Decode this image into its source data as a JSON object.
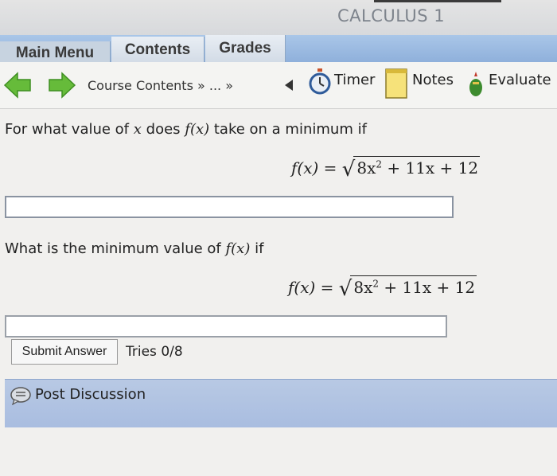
{
  "app": {
    "title": "CALCULUS 1"
  },
  "nav": {
    "tabs": [
      {
        "label": "Main Menu"
      },
      {
        "label": "Contents"
      },
      {
        "label": "Grades"
      }
    ]
  },
  "toolbar": {
    "breadcrumb": "Course Contents » ... »",
    "tools": [
      {
        "label": "Timer",
        "icon": "timer-icon"
      },
      {
        "label": "Notes",
        "icon": "notes-icon"
      },
      {
        "label": "Evaluate",
        "icon": "evaluate-icon"
      }
    ]
  },
  "question1": {
    "pre": "For what value of",
    "var": "x",
    "mid": "does",
    "func": "f(x)",
    "post": "take on a minimum if",
    "equation": {
      "lhs": "f(x) =",
      "radicand_a": "8x",
      "exp": "2",
      "radicand_b": "+ 11x + 12"
    },
    "answer_value": ""
  },
  "question2": {
    "pre": "What is the minimum value of",
    "func": "f(x)",
    "post": "if",
    "equation": {
      "lhs": "f(x) =",
      "radicand_a": "8x",
      "exp": "2",
      "radicand_b": "+ 11x + 12"
    },
    "answer_value": ""
  },
  "submit": {
    "label": "Submit Answer",
    "tries": "Tries 0/8"
  },
  "discussion": {
    "label": "Post Discussion"
  },
  "colors": {
    "nav_blue": "#9fbfe4",
    "discussion_blue": "#b0c3e2",
    "arrow_green": "#66bb3a"
  }
}
